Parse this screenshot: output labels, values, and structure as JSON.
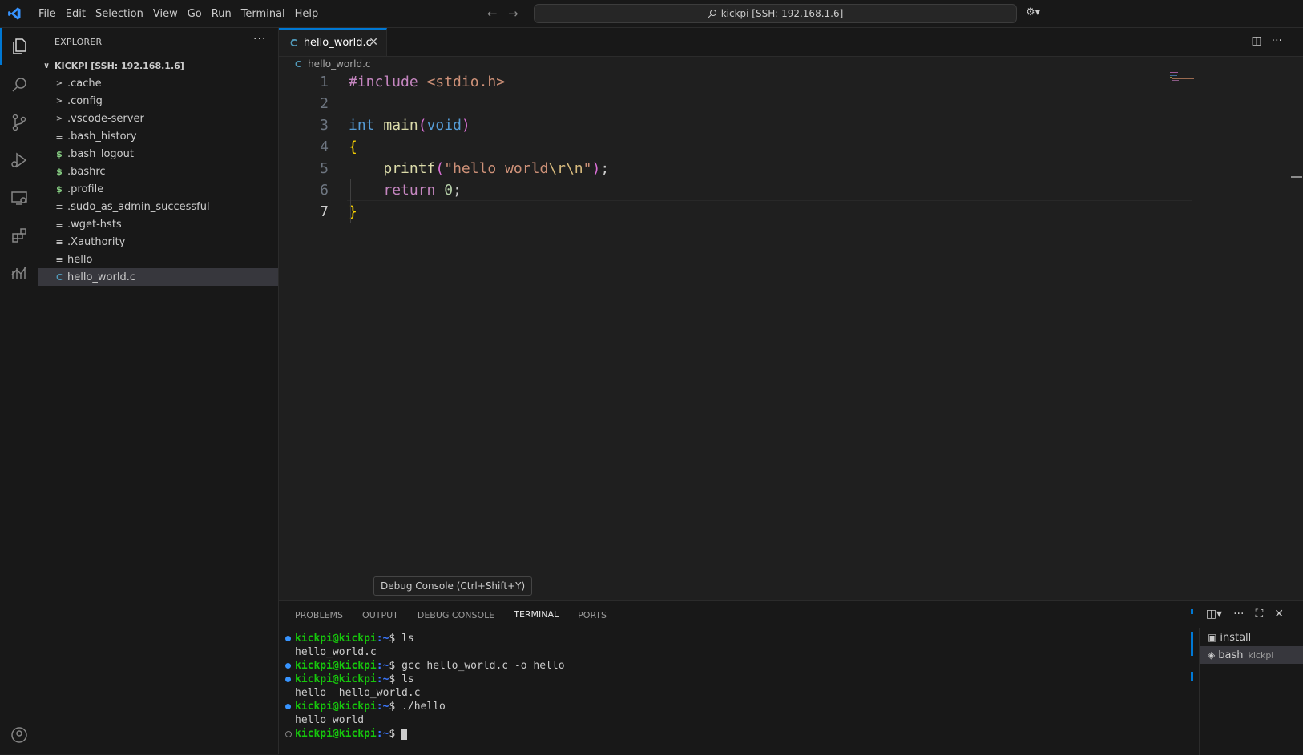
{
  "menu": [
    "File",
    "Edit",
    "Selection",
    "View",
    "Go",
    "Run",
    "Terminal",
    "Help"
  ],
  "command_center": "kickpi [SSH: 192.168.1.6]",
  "colors": {
    "accent": "#0078d4",
    "background": "#1f1f1f",
    "sidebar": "#181818"
  },
  "activity_icons": [
    "explorer-icon",
    "search-icon",
    "source-control-icon",
    "run-debug-icon",
    "remote-explorer-icon",
    "extensions-icon",
    "analytics-icon",
    "account-icon"
  ],
  "explorer": {
    "title": "EXPLORER",
    "root": "KICKPI [SSH: 192.168.1.6]",
    "items": [
      {
        "name": ".cache",
        "icon": "chevron-right-icon"
      },
      {
        "name": ".config",
        "icon": "chevron-right-icon"
      },
      {
        "name": ".vscode-server",
        "icon": "chevron-right-icon"
      },
      {
        "name": ".bash_history",
        "icon": "text-file-icon"
      },
      {
        "name": ".bash_logout",
        "icon": "shell-file-icon"
      },
      {
        "name": ".bashrc",
        "icon": "shell-file-icon"
      },
      {
        "name": ".profile",
        "icon": "shell-file-icon"
      },
      {
        "name": ".sudo_as_admin_successful",
        "icon": "text-file-icon"
      },
      {
        "name": ".wget-hsts",
        "icon": "text-file-icon"
      },
      {
        "name": ".Xauthority",
        "icon": "text-file-icon"
      },
      {
        "name": "hello",
        "icon": "text-file-icon"
      },
      {
        "name": "hello_world.c",
        "icon": "c-file-icon",
        "selected": true
      }
    ]
  },
  "editor": {
    "tab": "hello_world.c",
    "breadcrumb": "hello_world.c",
    "line_numbers": [
      "1",
      "2",
      "3",
      "4",
      "5",
      "6",
      "7"
    ],
    "current_line": "7",
    "code": {
      "l1_directive": "#include",
      "l1_header": "<stdio.h>",
      "l3_type": "int",
      "l3_fn": "main",
      "l3_open": "(",
      "l3_param": "void",
      "l3_close": ")",
      "l4": "{",
      "l5_fn": "printf",
      "l5_open": "(",
      "l5_str_a": "\"hello world",
      "l5_esc": "\\r\\n",
      "l5_str_b": "\"",
      "l5_close": ")",
      "l5_semi": ";",
      "l6_kw": "return",
      "l6_num": "0",
      "l6_semi": ";",
      "l7": "}"
    }
  },
  "tooltip": "Debug Console (Ctrl+Shift+Y)",
  "panel": {
    "tabs": [
      "PROBLEMS",
      "OUTPUT",
      "DEBUG CONSOLE",
      "TERMINAL",
      "PORTS"
    ],
    "active_tab": "TERMINAL",
    "prompt_user": "kickpi@kickpi",
    "prompt_path": ":~",
    "prompt_symbol": "$ ",
    "lines": [
      {
        "type": "cmd",
        "cmd": "ls"
      },
      {
        "type": "out",
        "text": "hello_world.c"
      },
      {
        "type": "cmd",
        "cmd": "gcc hello_world.c -o hello"
      },
      {
        "type": "cmd",
        "cmd": "ls"
      },
      {
        "type": "out",
        "text": "hello  hello_world.c"
      },
      {
        "type": "cmd",
        "cmd": "./hello"
      },
      {
        "type": "out",
        "text": "hello world"
      },
      {
        "type": "cmd",
        "cmd": ""
      }
    ],
    "terminals": [
      {
        "name": "install",
        "sub": ""
      },
      {
        "name": "bash",
        "sub": "kickpi"
      }
    ]
  }
}
